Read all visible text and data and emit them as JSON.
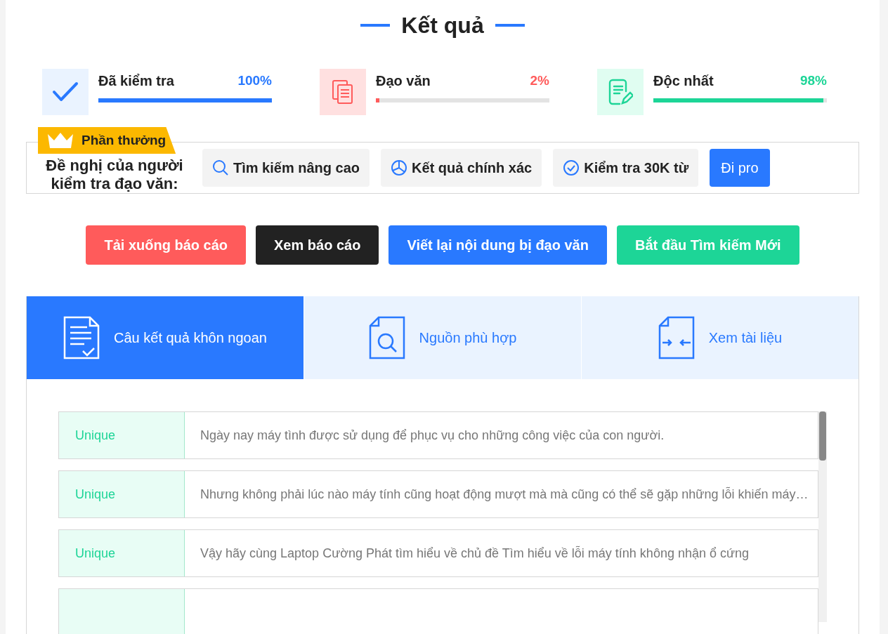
{
  "title": "Kết quả",
  "stats": [
    {
      "kind": "checked",
      "label": "Đã kiểm tra",
      "value": "100%",
      "level": 1,
      "color": "#2979ff"
    },
    {
      "kind": "plagiarism",
      "label": "Đạo văn",
      "value": "2%",
      "level": 0.02,
      "color": "#ff5b5b"
    },
    {
      "kind": "unique",
      "label": "Độc nhất",
      "value": "98%",
      "level": 0.98,
      "color": "#1dd597"
    }
  ],
  "promo": {
    "badge": "Phần thưởng",
    "heading": "Đề nghị của người kiểm tra đạo văn:",
    "features": [
      {
        "kind": "search",
        "label": "Tìm kiếm nâng cao"
      },
      {
        "kind": "chart",
        "label": "Kết quả chính xác"
      },
      {
        "kind": "check",
        "label": "Kiểm tra 30K từ"
      }
    ],
    "button": "Đi pro"
  },
  "actions": [
    {
      "label": "Tải xuống báo cáo",
      "color": "#ff5b5b"
    },
    {
      "label": "Xem báo cáo",
      "color": "#222222"
    },
    {
      "label": "Viết lại nội dung bị đạo văn",
      "color": "#2979ff"
    },
    {
      "label": "Bắt đầu Tìm kiếm Mới",
      "color": "#1dd597"
    }
  ],
  "tabs": [
    {
      "kind": "sentences",
      "label": "Câu kết quả khôn ngoan",
      "selected": true
    },
    {
      "kind": "sources",
      "label": "Nguồn phù hợp",
      "selected": false
    },
    {
      "kind": "compare",
      "label": "Xem tài liệu",
      "selected": false
    }
  ],
  "results": [
    {
      "status": "Unique",
      "text": "Ngày nay máy tình được sử dụng để phục vụ cho những công việc của con người."
    },
    {
      "status": "Unique",
      "text": "Nhưng không phải lúc nào máy tính cũng hoạt động mượt mà mà cũng có thể sẽ gặp những lỗi khiến máy…"
    },
    {
      "status": "Unique",
      "text": "Vậy hãy cùng Laptop Cường Phát tìm hiểu về chủ đề Tìm hiểu về lỗi máy tính không nhận ổ cứng"
    }
  ]
}
